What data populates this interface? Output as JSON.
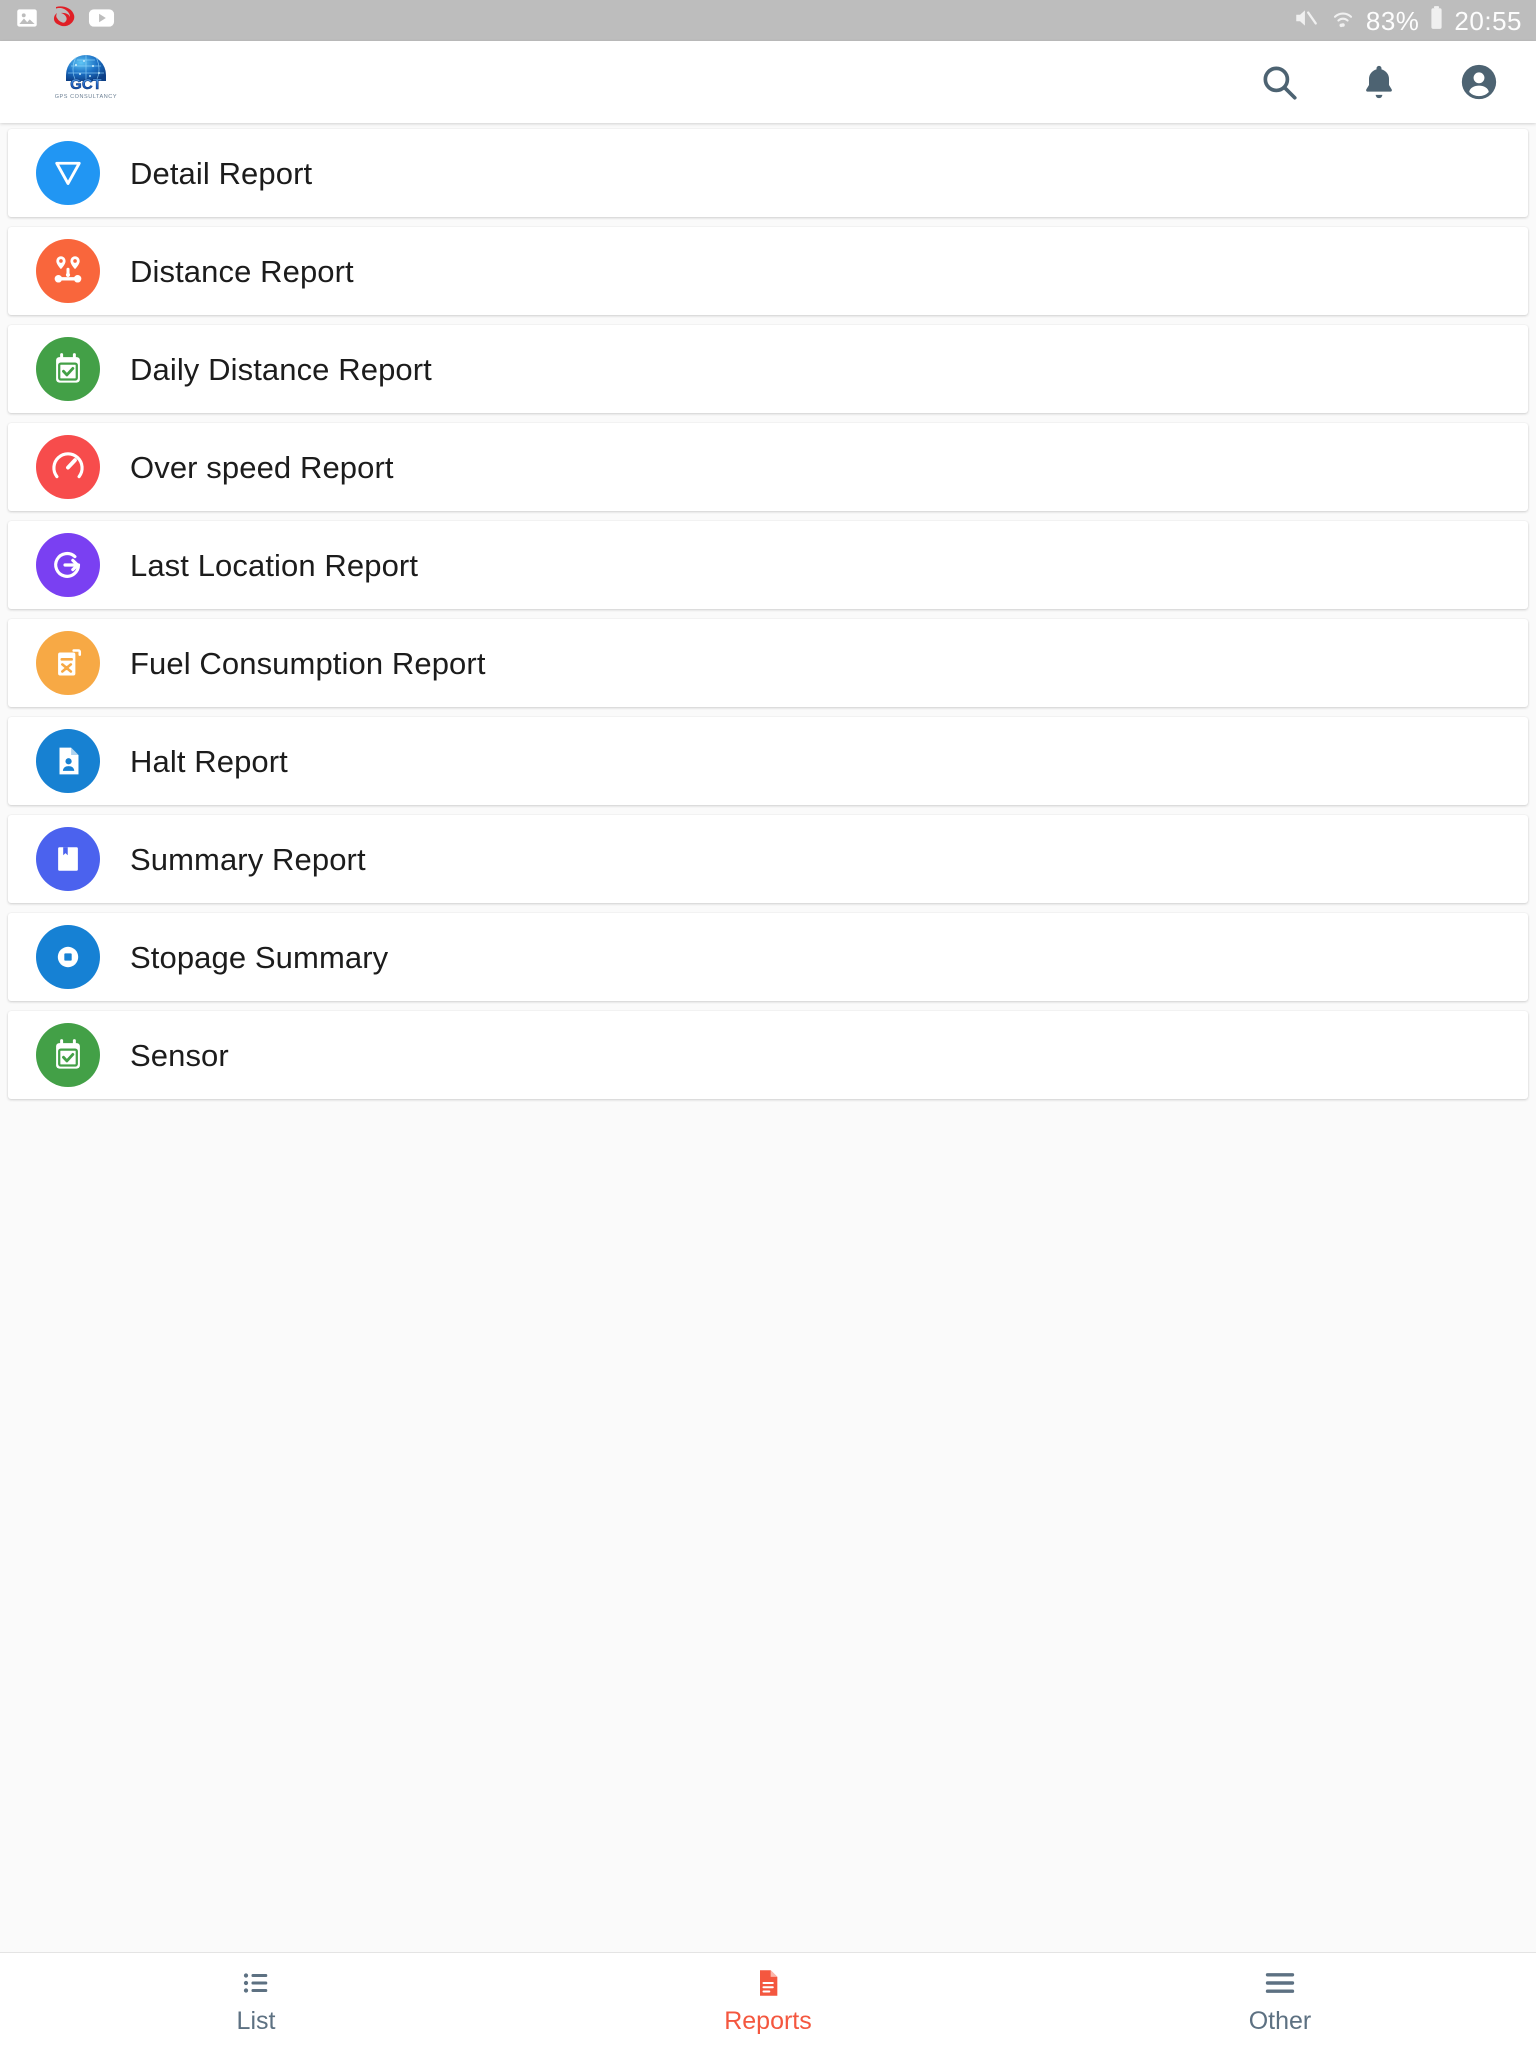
{
  "statusbar": {
    "left_icons": [
      "image-gallery-icon",
      "airtel-logo-icon",
      "youtube-icon"
    ],
    "right_icons": [
      "volume-mute-icon",
      "wifi-icon",
      "battery-icon"
    ],
    "battery_percent": "83%",
    "clock": "20:55",
    "background": "#bdbdbd"
  },
  "appbar": {
    "logo_name": "gct-logo",
    "logo_text": "GCT",
    "logo_subtext": "GPS CONSULTANCY",
    "actions": [
      {
        "name": "search-icon",
        "label": "Search"
      },
      {
        "name": "notifications-bell-icon",
        "label": "Notifications"
      },
      {
        "name": "account-circle-icon",
        "label": "Account"
      }
    ],
    "action_color": "#4d6372"
  },
  "reports": [
    {
      "label": "Detail Report",
      "icon": "filter-triangle-icon",
      "color": "#2196f3"
    },
    {
      "label": "Distance Report",
      "icon": "route-pins-icon",
      "color": "#f9663c"
    },
    {
      "label": "Daily Distance Report",
      "icon": "calendar-check-icon",
      "color": "#43a047"
    },
    {
      "label": "Over speed Report",
      "icon": "speedometer-icon",
      "color": "#f74c4c"
    },
    {
      "label": "Last Location Report",
      "icon": "location-refresh-icon",
      "color": "#7a40f2"
    },
    {
      "label": "Fuel Consumption Report",
      "icon": "fuel-canister-icon",
      "color": "#f7a945"
    },
    {
      "label": "Halt Report",
      "icon": "document-person-icon",
      "color": "#1781d2"
    },
    {
      "label": "Summary Report",
      "icon": "bookmark-book-icon",
      "color": "#4b62ee"
    },
    {
      "label": "Stopage Summary",
      "icon": "stop-circle-icon",
      "color": "#1681d4"
    },
    {
      "label": "Sensor",
      "icon": "calendar-check-icon",
      "color": "#43a047"
    }
  ],
  "bottomnav": {
    "active_color": "#f4573f",
    "inactive_color": "#5d7182",
    "items": [
      {
        "label": "List",
        "icon": "list-bullets-icon",
        "active": false
      },
      {
        "label": "Reports",
        "icon": "report-document-icon",
        "active": true
      },
      {
        "label": "Other",
        "icon": "hamburger-menu-icon",
        "active": false
      }
    ]
  }
}
